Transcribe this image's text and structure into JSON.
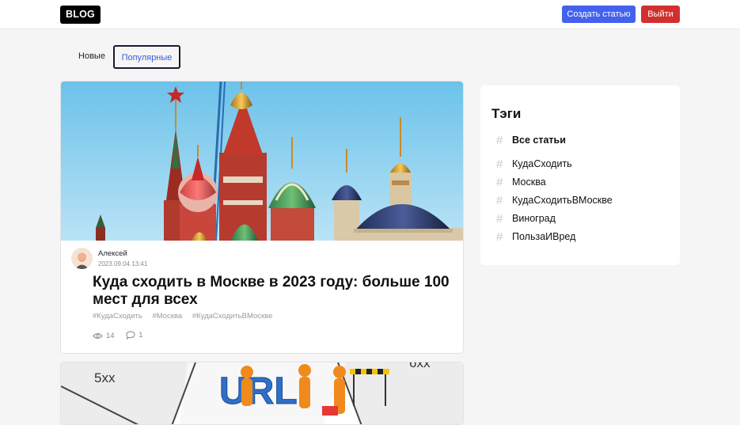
{
  "header": {
    "logo": "BLOG",
    "create_label": "Создать статью",
    "exit_label": "Выйти"
  },
  "tabs": [
    {
      "label": "Новые",
      "active": false
    },
    {
      "label": "Популярные",
      "active": true
    }
  ],
  "post": {
    "author": "Алексей",
    "date": "2023.09.04 13:41",
    "title": "Куда сходить в Москве в 2023 году: больше 100 мест для всех",
    "tags": [
      "#КудаСходить",
      "#Москва",
      "#КудаСходитьВМоскве"
    ],
    "views": "14",
    "comments": "1"
  },
  "post2": {
    "image_text_left": "5xx",
    "image_text_center": "URL",
    "image_text_right": "6xx"
  },
  "sidebar": {
    "title": "Тэги",
    "all_label": "Все статьи",
    "tags": [
      "КудаСходить",
      "Москва",
      "КудаСходитьВМоскве",
      "Виноград",
      "ПользаИВред"
    ]
  },
  "colors": {
    "primary": "#4361ee",
    "danger": "#d32f2f",
    "sky": "#8fd0ef"
  }
}
